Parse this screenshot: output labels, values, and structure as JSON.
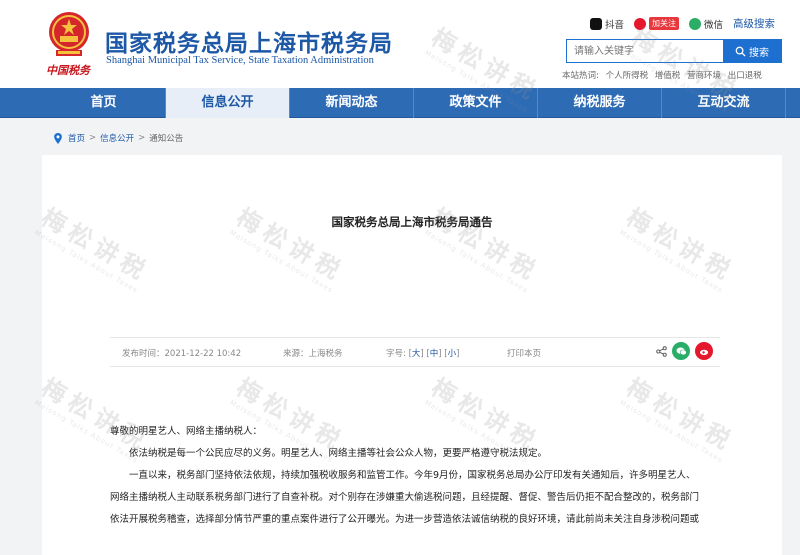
{
  "site": {
    "title_cn": "国家税务总局上海市税务局",
    "title_en": "Shanghai Municipal Tax Service, State Taxation Administration",
    "logo_caption": "中国税务"
  },
  "top_links": {
    "douyin": "抖音",
    "weibo_follow": "加关注",
    "wechat": "微信",
    "advanced_search": "高级搜索"
  },
  "search": {
    "placeholder": "请输入关键字",
    "button": "搜索",
    "hot_label": "本站热词:",
    "hot_words": [
      "个人所得税",
      "增值税",
      "营商环境",
      "出口退税"
    ]
  },
  "nav": [
    {
      "label": "首页",
      "active": false
    },
    {
      "label": "信息公开",
      "active": true
    },
    {
      "label": "新闻动态",
      "active": false
    },
    {
      "label": "政策文件",
      "active": false
    },
    {
      "label": "纳税服务",
      "active": false
    },
    {
      "label": "互动交流",
      "active": false
    }
  ],
  "breadcrumb": [
    "首页",
    "信息公开",
    "通知公告"
  ],
  "article": {
    "title": "国家税务总局上海市税务局通告",
    "meta": {
      "publish": "发布时间：2021-12-22 10:42",
      "source": "来源：上海税务",
      "font_label": "字号:",
      "font_large": "大",
      "font_medium": "中",
      "font_small": "小",
      "print": "打印本页"
    },
    "paragraphs": [
      "尊敬的明星艺人、网络主播纳税人：",
      "依法纳税是每一个公民应尽的义务。明星艺人、网络主播等社会公众人物，更要严格遵守税法规定。",
      "一直以来，税务部门坚持依法依规，持续加强税收服务和监管工作。今年9月份，国家税务总局办公厅印发有关通知后，许多明星艺人、",
      "网络主播纳税人主动联系税务部门进行了自查补税。对个别存在涉嫌重大偷逃税问题，且经提醒、督促、警告后仍拒不配合整改的，税务部门",
      "依法开展税务稽查，选择部分情节严重的重点案件进行了公开曝光。为进一步营造依法诚信纳税的良好环境，请此前尚未关注自身涉税问题或"
    ]
  },
  "watermark": {
    "text": "梅松讲税",
    "sub": "Meisong Talks About Taxes"
  },
  "colors": {
    "brand_blue": "#1d58a7",
    "nav_blue": "#2e6bb5",
    "accent_red": "#c8161d",
    "wechat_green": "#2aae67",
    "weibo_red": "#e6162d"
  }
}
